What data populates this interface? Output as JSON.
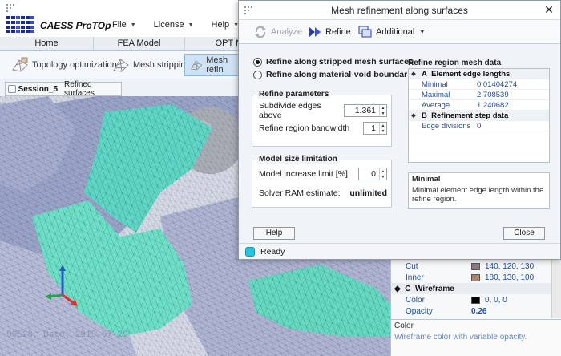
{
  "app": {
    "title": "CAESS ProTOp",
    "menu": [
      {
        "label": "File"
      },
      {
        "label": "License"
      },
      {
        "label": "Help"
      }
    ],
    "tabs": [
      "Home",
      "FEA Model",
      "OPT Mo"
    ],
    "ribbon": {
      "topology": "Topology optimization",
      "stripping": "Mesh stripping",
      "refine": "Mesh refin"
    },
    "session": {
      "name": "Session_5",
      "view": "Refined surfaces"
    },
    "status_overlay": "90528, Date: 2019-07-29"
  },
  "property_panel": {
    "rows": [
      {
        "label": "Cut",
        "value": "140, 120, 130",
        "color": "#8c7882"
      },
      {
        "label": "Inner",
        "value": "180, 130, 100",
        "color": "#b48264"
      }
    ],
    "section": {
      "letter": "C",
      "label": "Wireframe"
    },
    "wire_rows": [
      {
        "label": "Color",
        "value": "0, 0, 0",
        "color": "#000000"
      },
      {
        "label": "Opacity",
        "value": "0.26"
      }
    ],
    "help_title": "Color",
    "help_text": "Wireframe color with variable opacity."
  },
  "dialog": {
    "title": "Mesh refinement along surfaces",
    "toolbar": {
      "analyze": "Analyze",
      "refine": "Refine",
      "additional": "Additional"
    },
    "radios": [
      {
        "label": "Refine along stripped mesh surfaces",
        "checked": true
      },
      {
        "label": "Refine along material-void boundaries",
        "checked": false
      }
    ],
    "refinement": {
      "title": "Refine parameters",
      "subdivide_label": "Subdivide edges above",
      "subdivide_value": "1.361",
      "bandwidth_label": "Refine region bandwidth",
      "bandwidth_value": "1"
    },
    "model_size": {
      "title": "Model size limitation",
      "increase_label": "Model increase limit [%]",
      "increase_value": "0",
      "ram_label": "Solver RAM estimate:",
      "ram_value": "unlimited"
    },
    "region_data": {
      "title": "Refine region mesh data",
      "sec_a": {
        "letter": "A",
        "label": "Element edge lengths"
      },
      "a_rows": [
        {
          "key": "Minimal",
          "value": "0.01404274"
        },
        {
          "key": "Maximal",
          "value": "2.708539"
        },
        {
          "key": "Average",
          "value": "1.240682"
        }
      ],
      "sec_b": {
        "letter": "B",
        "label": "Refinement step data"
      },
      "b_rows": [
        {
          "key": "Edge divisions",
          "value": "0"
        }
      ]
    },
    "info": {
      "title": "Minimal",
      "text": "Minimal element edge length within the refine region."
    },
    "buttons": {
      "help": "Help",
      "close": "Close"
    },
    "status": "Ready",
    "accent": "#24c6e3"
  }
}
